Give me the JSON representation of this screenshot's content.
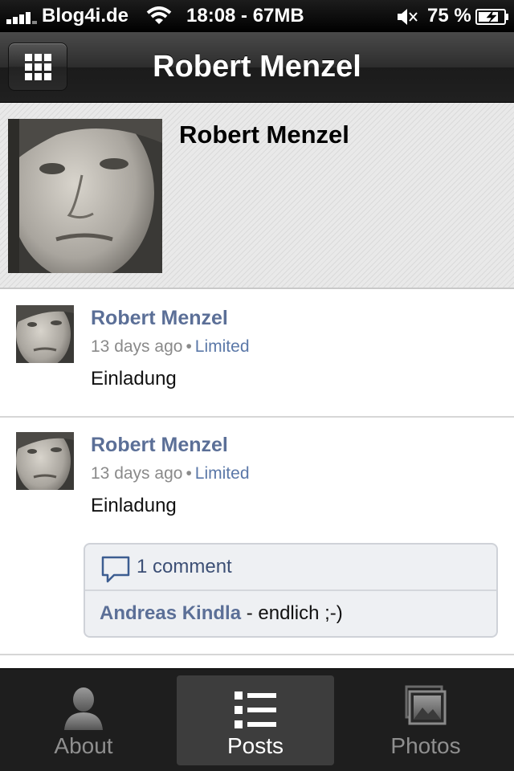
{
  "status_bar": {
    "carrier": "Blog4i.de",
    "time_memory": "18:08 - 67MB",
    "battery_percent": "75 %",
    "icons": [
      "signal-icon",
      "wifi-icon",
      "mute-icon",
      "battery-charging-icon"
    ]
  },
  "nav": {
    "title": "Robert Menzel",
    "menu_icon": "grid-icon"
  },
  "profile": {
    "name": "Robert Menzel"
  },
  "posts": [
    {
      "author": "Robert Menzel",
      "time": "13 days ago",
      "separator": "•",
      "visibility": "Limited",
      "text": "Einladung"
    },
    {
      "author": "Robert Menzel",
      "time": "13 days ago",
      "separator": "•",
      "visibility": "Limited",
      "text": "Einladung",
      "comments": {
        "count_label": "1 comment",
        "items": [
          {
            "author": "Andreas Kindla",
            "text": "- endlich ;-)"
          }
        ]
      }
    }
  ],
  "tabs": [
    {
      "label": "About",
      "icon": "person-icon",
      "selected": false
    },
    {
      "label": "Posts",
      "icon": "list-icon",
      "selected": true
    },
    {
      "label": "Photos",
      "icon": "photos-icon",
      "selected": false
    }
  ],
  "colors": {
    "link_blue": "#5b6f97",
    "nav_dark": "#2d2d2d",
    "tab_selected": "#3d3d3d"
  }
}
